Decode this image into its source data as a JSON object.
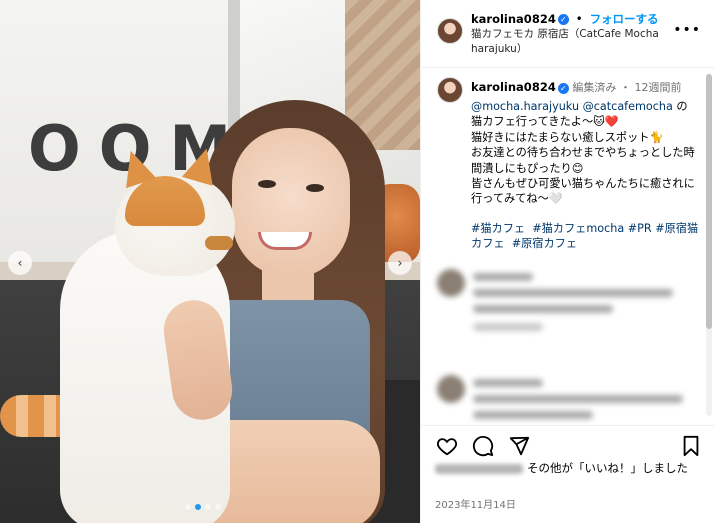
{
  "post": {
    "username": "karolina0824",
    "verified_icon": "verified-badge-icon",
    "separator": "•",
    "follow_label": "フォローする",
    "location": "猫カフェモカ 原宿店（CatCafe Mocha harajuku）",
    "more_icon": "more-horizontal-icon"
  },
  "caption": {
    "username": "karolina0824",
    "edited": "編集済み",
    "time_ago": "12週間前",
    "mention1": "@mocha.harajyuku",
    "mention2": "@catcafemocha",
    "line1_suffix": " の",
    "line2": "猫カフェ行ってきたよ〜🐱❤️",
    "line3": "猫好きにはたまらない癒しスポット🐈",
    "line4": "お友達との待ち合わせまでやちょっとした時間潰しにもぴったり😊",
    "line5": "皆さんもぜひ可愛い猫ちゃんたちに癒されに行ってみてね〜🤍",
    "hashtags": [
      "#猫カフェ",
      "#猫カフェmocha",
      "#PR",
      "#原宿猫カフェ",
      "#原宿カフェ"
    ]
  },
  "actions": {
    "like_icon": "heart-icon",
    "comment_icon": "comment-icon",
    "share_icon": "share-icon",
    "save_icon": "bookmark-icon",
    "likes_text": "その他が「いいね！」しました",
    "date": "2023年11月14日"
  },
  "photo": {
    "sign_text": "OOM",
    "prev_icon": "chevron-left-icon",
    "next_icon": "chevron-right-icon",
    "carousel_count": 4,
    "carousel_active": 1
  },
  "colors": {
    "link": "#00376b",
    "follow": "#0095f6",
    "verified": "#1877f2",
    "muted": "#737373"
  }
}
